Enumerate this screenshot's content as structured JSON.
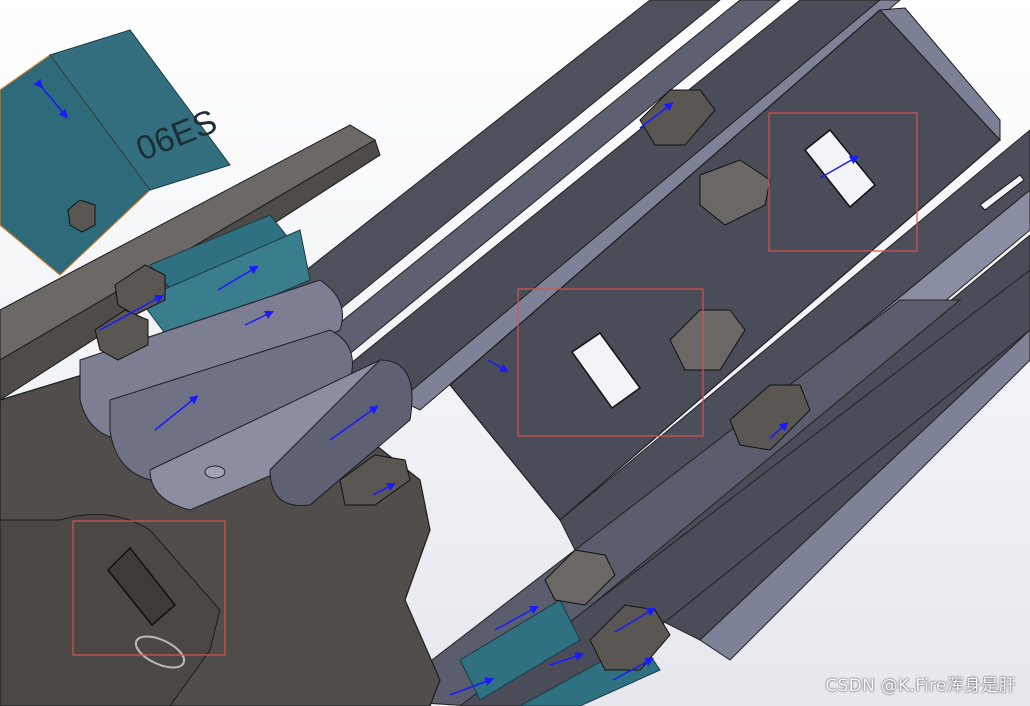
{
  "window": {
    "title": ""
  },
  "viewport": {
    "background_top": "#ffffff",
    "background_bottom": "#e8eaef"
  },
  "servo": {
    "label": "06ES",
    "color": "#2e6b7a"
  },
  "colors": {
    "plate_dark": "#4a4c58",
    "plate_mid": "#5b5e6c",
    "plate_light": "#8a8ea0",
    "metal_gray": "#6e6b68",
    "nut": "#5a5753",
    "highlight_box": "#d9534f",
    "sketch_arrow": "#1a1aff"
  },
  "highlights": [
    {
      "id": "box-slot-upper-right",
      "label": ""
    },
    {
      "id": "box-slot-center",
      "label": ""
    },
    {
      "id": "box-slot-lower-left",
      "label": ""
    }
  ],
  "watermark": {
    "text": "CSDN @K.Fire浑身是肝"
  }
}
